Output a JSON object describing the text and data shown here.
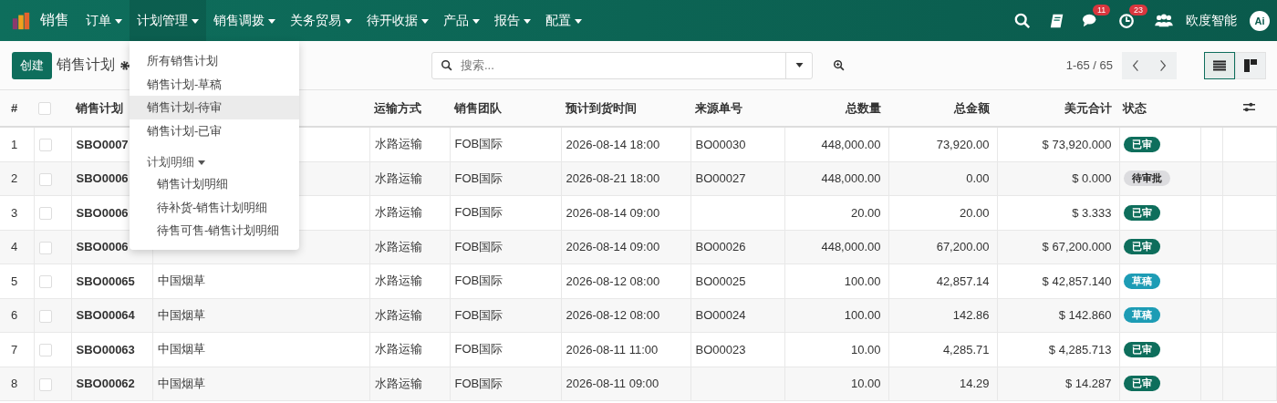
{
  "navbar": {
    "app": "销售",
    "menus": [
      {
        "label": "订单",
        "selected": false
      },
      {
        "label": "计划管理",
        "selected": true
      },
      {
        "label": "销售调拨",
        "selected": false
      },
      {
        "label": "关务贸易",
        "selected": false
      },
      {
        "label": "待开收据",
        "selected": false
      },
      {
        "label": "产品",
        "selected": false
      },
      {
        "label": "报告",
        "selected": false
      },
      {
        "label": "配置",
        "selected": false
      }
    ],
    "messages_count": "11",
    "activities_count": "23",
    "company": "欧度智能",
    "avatar_text": "Ai"
  },
  "dropdown": {
    "items": [
      {
        "label": "所有销售计划",
        "selected": false
      },
      {
        "label": "销售计划-草稿",
        "selected": false
      },
      {
        "label": "销售计划-待审",
        "selected": true
      },
      {
        "label": "销售计划-已审",
        "selected": false
      }
    ],
    "group": "计划明细",
    "sub_items": [
      {
        "label": "销售计划明细"
      },
      {
        "label": "待补货-销售计划明细"
      },
      {
        "label": "待售可售-销售计划明细"
      }
    ]
  },
  "control_panel": {
    "create": "创建",
    "title": "销售计划",
    "search_placeholder": "搜索...",
    "pager": "1-65 / 65",
    "views": [
      {
        "kind": "list",
        "selected": true
      },
      {
        "kind": "kanban",
        "selected": false
      }
    ]
  },
  "table": {
    "select_all_checked": false,
    "columns": [
      "#",
      "销售计划",
      "运输方式",
      "销售团队",
      "预计到货时间",
      "来源单号",
      "总数量",
      "总金额",
      "美元合计",
      "状态"
    ],
    "rows": [
      {
        "num": "1",
        "checked": false,
        "code": "SBO0007",
        "shipping": "水路运输",
        "team": "FOB国际",
        "eta": "2026-08-14 18:00",
        "source": "BO00030",
        "qty": "448,000.00",
        "amount": "73,920.00",
        "usd": "$ 73,920.000",
        "status": {
          "label": "已审",
          "kind": "approved"
        }
      },
      {
        "num": "2",
        "checked": false,
        "code": "SBO0006",
        "shipping": "水路运输",
        "team": "FOB国际",
        "eta": "2026-08-21 18:00",
        "source": "BO00027",
        "qty": "448,000.00",
        "amount": "0.00",
        "usd": "$ 0.000",
        "status": {
          "label": "待审批",
          "kind": "pending"
        }
      },
      {
        "num": "3",
        "checked": false,
        "code": "SBO0006",
        "shipping": "水路运输",
        "team": "FOB国际",
        "eta": "2026-08-14 09:00",
        "qty": "20.00",
        "amount": "20.00",
        "usd": "$ 3.333",
        "status": {
          "label": "已审",
          "kind": "approved"
        }
      },
      {
        "num": "4",
        "checked": false,
        "code": "SBO0006",
        "shipping": "水路运输",
        "team": "FOB国际",
        "eta": "2026-08-14 09:00",
        "source": "BO00026",
        "qty": "448,000.00",
        "amount": "67,200.00",
        "usd": "$ 67,200.000",
        "status": {
          "label": "已审",
          "kind": "approved"
        }
      },
      {
        "num": "5",
        "checked": false,
        "code": "SBO00065",
        "customer": "中国烟草",
        "shipping": "水路运输",
        "team": "FOB国际",
        "eta": "2026-08-12 08:00",
        "source": "BO00025",
        "qty": "100.00",
        "amount": "42,857.14",
        "usd": "$ 42,857.140",
        "status": {
          "label": "草稿",
          "kind": "draft"
        }
      },
      {
        "num": "6",
        "checked": false,
        "code": "SBO00064",
        "customer": "中国烟草",
        "shipping": "水路运输",
        "team": "FOB国际",
        "eta": "2026-08-12 08:00",
        "source": "BO00024",
        "qty": "100.00",
        "amount": "142.86",
        "usd": "$ 142.860",
        "status": {
          "label": "草稿",
          "kind": "draft"
        }
      },
      {
        "num": "7",
        "checked": false,
        "code": "SBO00063",
        "customer": "中国烟草",
        "shipping": "水路运输",
        "team": "FOB国际",
        "eta": "2026-08-11 11:00",
        "source": "BO00023",
        "qty": "10.00",
        "amount": "4,285.71",
        "usd": "$ 4,285.713",
        "status": {
          "label": "已审",
          "kind": "approved"
        }
      },
      {
        "num": "8",
        "checked": false,
        "code": "SBO00062",
        "customer": "中国烟草",
        "shipping": "水路运输",
        "team": "FOB国际",
        "eta": "2026-08-11 09:00",
        "qty": "10.00",
        "amount": "14.29",
        "usd": "$ 14.287",
        "status": {
          "label": "已审",
          "kind": "approved"
        }
      }
    ]
  }
}
